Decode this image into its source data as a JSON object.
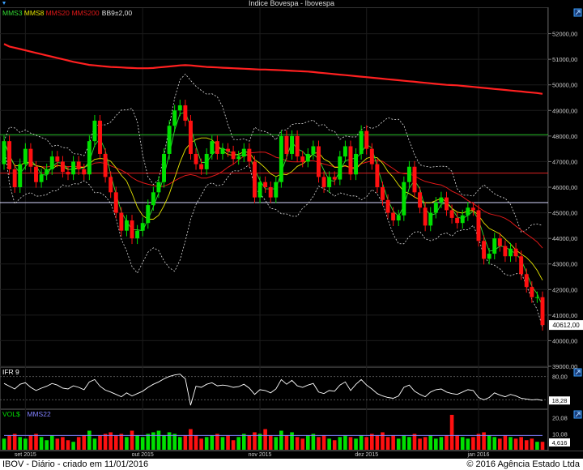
{
  "title": "Indice Bovespa - Ibovespa",
  "footer": {
    "left": "IBOV - Diário - criado em 11/01/2016",
    "right": "© 2016 Agência Estado Ltda"
  },
  "colors": {
    "background": "#000000",
    "grid": "#1c1c1c",
    "up": "#00e000",
    "down": "#ff1010",
    "mms3": "#33dd33",
    "mms8": "#e6e600",
    "mms20": "#e01818",
    "mms200": "#ff2020",
    "bb": "#e0e0e0",
    "hline_green": "#22bb22",
    "hline_red": "#dd2222",
    "hline_white": "#d8d8ff",
    "vol_avg": "#8080ff",
    "axis_text": "#cccccc"
  },
  "icons": [
    "chevron-down-icon",
    "expand-icon"
  ],
  "chart_data": [
    {
      "id": "price",
      "type": "candlestick",
      "legend": [
        {
          "label": "MMS3",
          "color": "#33dd33"
        },
        {
          "label": "MMS8",
          "color": "#e6e600"
        },
        {
          "label": "MMS20",
          "color": "#e01818"
        },
        {
          "label": "MMS200",
          "color": "#e01818"
        },
        {
          "label": "BB9±2,00",
          "color": "#e0e0e0"
        }
      ],
      "ylim": [
        39000,
        53000
      ],
      "y_ticks": [
        "52000,00",
        "51000,00",
        "50000,00",
        "49000,00",
        "48000,00",
        "47000,00",
        "46000,00",
        "45000,00",
        "44000,00",
        "43000,00",
        "42000,00",
        "41000,00",
        "40000,00",
        "39000,00"
      ],
      "x_ticks": [
        {
          "label": "set 2015",
          "index": 4
        },
        {
          "label": "out 2015",
          "index": 26
        },
        {
          "label": "nov 2015",
          "index": 48
        },
        {
          "label": "dez 2015",
          "index": 68
        },
        {
          "label": "jan 2016",
          "index": 89
        }
      ],
      "last_value": "40612,00",
      "hlines": [
        {
          "value": 48050,
          "color": "#22bb22"
        },
        {
          "value": 46550,
          "color": "#dd2222"
        },
        {
          "value": 45400,
          "color": "#d8d8ff"
        }
      ],
      "close": [
        47800,
        46700,
        46000,
        46900,
        47500,
        46800,
        46200,
        46500,
        46700,
        47200,
        47000,
        46600,
        46500,
        47000,
        46700,
        46500,
        47800,
        48600,
        47300,
        46400,
        45800,
        45000,
        44300,
        44700,
        44000,
        44300,
        44600,
        45300,
        45800,
        46200,
        47300,
        48400,
        49000,
        49200,
        48600,
        47300,
        46900,
        46700,
        47300,
        47800,
        47300,
        47500,
        47400,
        47100,
        47200,
        47500,
        47000,
        45600,
        46200,
        46000,
        45600,
        46200,
        48000,
        47300,
        48000,
        47200,
        47000,
        47300,
        47600,
        46400,
        46000,
        46400,
        46300,
        47200,
        47600,
        46500,
        47300,
        48200,
        47500,
        46900,
        46000,
        45500,
        45000,
        44700,
        44900,
        46200,
        46800,
        45800,
        45200,
        44500,
        45000,
        45400,
        45600,
        45100,
        44800,
        44600,
        44900,
        45200,
        45100,
        43900,
        43200,
        43400,
        44000,
        43700,
        43300,
        43600,
        43300,
        42600,
        42100,
        41700,
        41700,
        40612
      ],
      "open": [
        46900,
        47800,
        46700,
        46000,
        46900,
        47500,
        46800,
        46200,
        46500,
        46700,
        47200,
        47000,
        46600,
        46500,
        47000,
        46700,
        46500,
        47800,
        48600,
        47300,
        46400,
        45800,
        45000,
        44300,
        44700,
        44000,
        44300,
        44600,
        45300,
        45800,
        46200,
        47300,
        48400,
        49000,
        49200,
        48600,
        47300,
        46900,
        46700,
        47300,
        47800,
        47300,
        47500,
        47400,
        47100,
        47200,
        47500,
        47000,
        45600,
        46200,
        46000,
        45600,
        46200,
        48000,
        47300,
        48000,
        47200,
        47000,
        47300,
        47600,
        46400,
        46000,
        46400,
        46300,
        47200,
        47600,
        46500,
        47300,
        48200,
        47500,
        46900,
        46000,
        45500,
        45000,
        44700,
        44900,
        46200,
        46800,
        45800,
        45200,
        44500,
        45000,
        45400,
        45600,
        45100,
        44800,
        44600,
        44900,
        45200,
        45100,
        43900,
        43200,
        43400,
        44000,
        43700,
        43300,
        43600,
        43300,
        42600,
        42100,
        41700,
        41700
      ],
      "mms200": [
        51600,
        51500,
        51450,
        51400,
        51350,
        51300,
        51250,
        51200,
        51150,
        51100,
        51050,
        51000,
        50950,
        50900,
        50860,
        50820,
        50780,
        50760,
        50740,
        50720,
        50700,
        50690,
        50680,
        50670,
        50660,
        50650,
        50650,
        50650,
        50660,
        50680,
        50700,
        50720,
        50740,
        50760,
        50770,
        50760,
        50740,
        50720,
        50700,
        50690,
        50680,
        50670,
        50660,
        50650,
        50640,
        50630,
        50620,
        50610,
        50600,
        50600,
        50590,
        50580,
        50570,
        50560,
        50550,
        50540,
        50530,
        50520,
        50500,
        50480,
        50460,
        50440,
        50420,
        50400,
        50380,
        50360,
        50340,
        50320,
        50300,
        50280,
        50260,
        50240,
        50220,
        50200,
        50180,
        50160,
        50140,
        50120,
        50100,
        50080,
        50060,
        50040,
        50020,
        50000,
        49990,
        49980,
        49960,
        49940,
        49920,
        49900,
        49880,
        49860,
        49840,
        49820,
        49800,
        49780,
        49760,
        49740,
        49720,
        49700,
        49680,
        49650
      ]
    },
    {
      "id": "ifr",
      "type": "line",
      "label": "IFR 9",
      "ylim": [
        0,
        100
      ],
      "y_ticks": [
        "80,00"
      ],
      "last_value": "18,28",
      "values": [
        62,
        55,
        48,
        60,
        64,
        52,
        44,
        50,
        55,
        62,
        58,
        50,
        48,
        56,
        52,
        46,
        66,
        72,
        55,
        45,
        40,
        34,
        28,
        38,
        30,
        36,
        42,
        52,
        60,
        66,
        74,
        80,
        84,
        86,
        74,
        6,
        55,
        52,
        60,
        64,
        56,
        58,
        56,
        52,
        54,
        60,
        50,
        34,
        46,
        44,
        38,
        48,
        72,
        60,
        70,
        56,
        52,
        58,
        62,
        40,
        36,
        44,
        42,
        58,
        66,
        44,
        60,
        72,
        58,
        48,
        36,
        30,
        26,
        24,
        30,
        52,
        58,
        42,
        34,
        28,
        40,
        46,
        48,
        40,
        36,
        34,
        40,
        46,
        44,
        26,
        20,
        26,
        38,
        32,
        28,
        34,
        30,
        24,
        22,
        20,
        21,
        18.28
      ]
    },
    {
      "id": "volume",
      "type": "bar",
      "label": "VOL$",
      "legend": [
        {
          "label": "VOL$",
          "color": "#00e000"
        },
        {
          "label": "MMS22",
          "color": "#8080ff"
        }
      ],
      "ylim": [
        0,
        24
      ],
      "y_ticks": [
        "20,08",
        "10,08"
      ],
      "last_value": "4,616",
      "values": [
        7,
        9,
        10,
        8,
        7,
        9,
        10,
        8,
        6,
        9,
        7,
        8,
        6,
        5,
        8,
        9,
        12,
        7,
        9,
        10,
        11,
        9,
        10,
        8,
        12,
        9,
        8,
        10,
        11,
        12,
        9,
        11,
        10,
        8,
        9,
        13,
        9,
        7,
        8,
        9,
        10,
        8,
        9,
        6,
        8,
        10,
        9,
        11,
        10,
        13,
        9,
        8,
        12,
        9,
        11,
        8,
        7,
        9,
        10,
        8,
        9,
        7,
        6,
        8,
        9,
        8,
        7,
        9,
        8,
        10,
        9,
        11,
        8,
        9,
        7,
        9,
        8,
        10,
        7,
        8,
        9,
        7,
        8,
        9,
        22,
        9,
        8,
        7,
        8,
        10,
        11,
        9,
        8,
        7,
        9,
        8,
        7,
        8,
        6,
        7,
        5,
        5
      ],
      "mms22": [
        9,
        9,
        9,
        9,
        9,
        9,
        9,
        9,
        9,
        9,
        9,
        9,
        9,
        9,
        9,
        9,
        9,
        9,
        9,
        9,
        9,
        9,
        9,
        9,
        9,
        9,
        9,
        9,
        9,
        9,
        9,
        9,
        9,
        9,
        9,
        9,
        9,
        9,
        9,
        9,
        9,
        9,
        9,
        9,
        9,
        9,
        9,
        9,
        9,
        9,
        9,
        9,
        9,
        9,
        9,
        9,
        9,
        9,
        9,
        9,
        9,
        9,
        9,
        9,
        9,
        9,
        9,
        9,
        9,
        9,
        9,
        9,
        9,
        9,
        9,
        9,
        9,
        9,
        9,
        9,
        9,
        9,
        9,
        9,
        9,
        9,
        9,
        9,
        9,
        9,
        9,
        9,
        9,
        9,
        9,
        9,
        9,
        9,
        9,
        9,
        9,
        9
      ]
    }
  ]
}
